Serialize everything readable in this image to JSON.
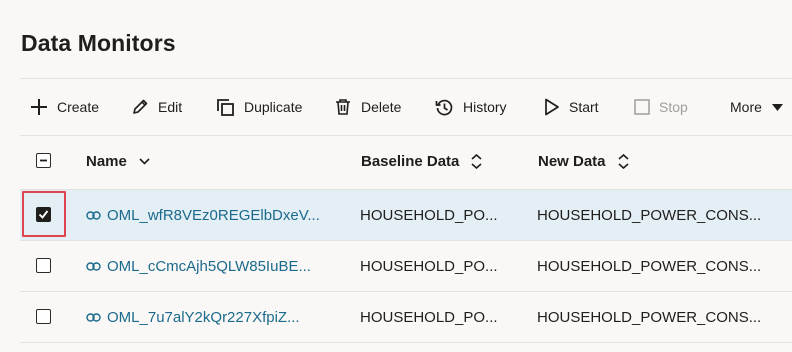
{
  "page": {
    "title": "Data Monitors"
  },
  "toolbar": {
    "create": "Create",
    "edit": "Edit",
    "duplicate": "Duplicate",
    "delete": "Delete",
    "history": "History",
    "start": "Start",
    "stop": "Stop",
    "more": "More"
  },
  "table": {
    "columns": {
      "name": "Name",
      "baseline": "Baseline Data",
      "new_data": "New Data"
    },
    "rows": [
      {
        "name": "OML_wfR8VEz0REGElbDxeV...",
        "baseline": "HOUSEHOLD_PO...",
        "new_data": "HOUSEHOLD_POWER_CONS...",
        "checked": true
      },
      {
        "name": "OML_cCmcAjh5QLW85IuBE...",
        "baseline": "HOUSEHOLD_PO...",
        "new_data": "HOUSEHOLD_POWER_CONS...",
        "checked": false
      },
      {
        "name": "OML_7u7alY2kQr227XfpiZ...",
        "baseline": "HOUSEHOLD_PO...",
        "new_data": "HOUSEHOLD_POWER_CONS...",
        "checked": false
      }
    ]
  },
  "colors": {
    "accent_link": "#1b6a8c",
    "selected_row": "#e3eff5",
    "highlight": "#e0454f"
  }
}
